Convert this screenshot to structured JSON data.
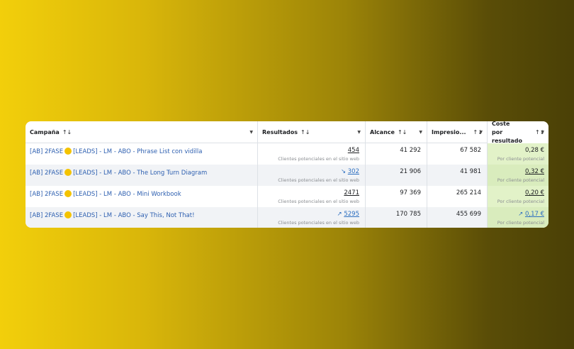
{
  "columns": [
    {
      "label": "Campaña"
    },
    {
      "label": "Resultados"
    },
    {
      "label": "Alcance"
    },
    {
      "label": "Impresio..."
    },
    {
      "label": "Coste por resultado",
      "line1": "Coste por",
      "line2": "resultado"
    }
  ],
  "sort_icon": "↑↓",
  "dropdown_icon": "▼",
  "rows": [
    {
      "prefix": "[AB] 2FASE",
      "suffix": "[LEADS] - LM - ABO - Phrase List con vidilla",
      "results": "454",
      "results_trend": "",
      "results_sub": "Clientes potenciales en el sitio web",
      "reach": "41 292",
      "impressions": "67 582",
      "cost": "0,28 €",
      "cost_trend": "",
      "cost_sub": "Por cliente potencial"
    },
    {
      "prefix": "[AB] 2FASE",
      "suffix": "[LEADS] - LM - ABO - The Long Turn Diagram",
      "results": "302",
      "results_trend": "↘",
      "results_sub": "Clientes potenciales en el sitio web",
      "reach": "21 906",
      "impressions": "41 981",
      "cost": "0,32 €",
      "cost_trend": "",
      "cost_sub": "Por cliente potencial"
    },
    {
      "prefix": "[AB] 2FASE",
      "suffix": "[LEADS] - LM - ABO - Mini Workbook",
      "results": "2471",
      "results_trend": "",
      "results_sub": "Clientes potenciales en el sitio web",
      "reach": "97 369",
      "impressions": "265 214",
      "cost": "0,20 €",
      "cost_trend": "",
      "cost_sub": "Por cliente potencial"
    },
    {
      "prefix": "[AB] 2FASE",
      "suffix": "[LEADS] - LM - ABO - Say This, Not That!",
      "results": "5295",
      "results_trend": "↗",
      "results_sub": "Clientes potenciales en el sitio web",
      "reach": "170 785",
      "impressions": "455 699",
      "cost": "0,17 €",
      "cost_trend": "↗",
      "cost_sub": "Por cliente potencial"
    }
  ],
  "colors": {
    "link": "#2d5fb0",
    "cost_bg": "#e2f2c8",
    "emoji": "#f4c300"
  }
}
